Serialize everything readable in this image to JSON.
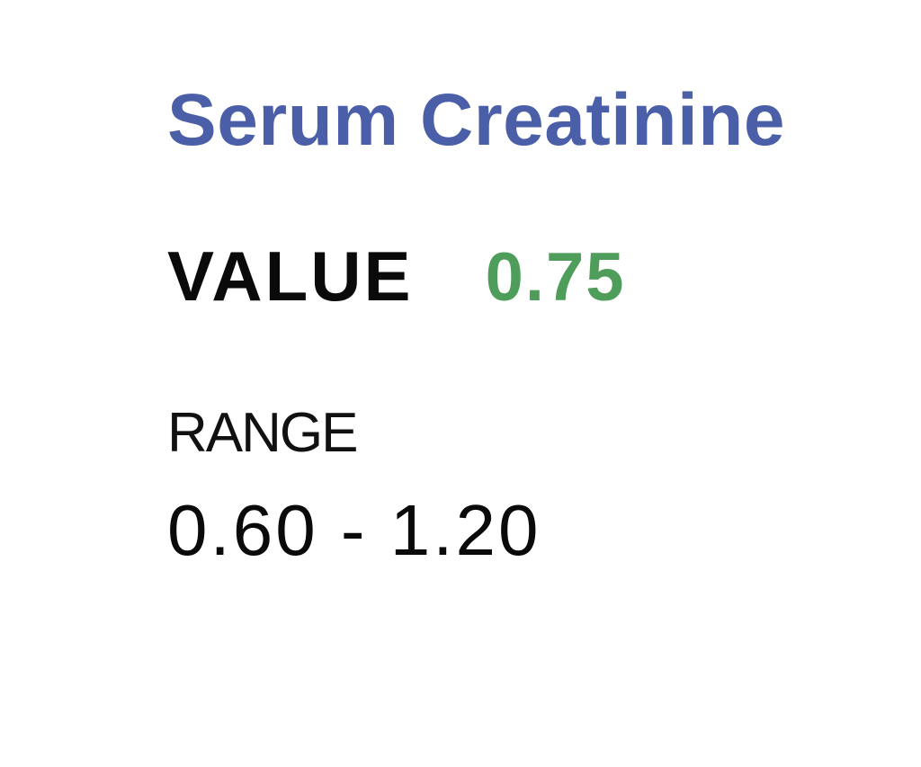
{
  "test": {
    "name": "Serum Creatinine",
    "name_color": "#4a5fa8"
  },
  "result": {
    "value_label": "VALUE",
    "value": "0.75",
    "value_color": "#4f9d5a"
  },
  "reference": {
    "range_label": "RANGE",
    "range_value": "0.60 - 1.20"
  }
}
